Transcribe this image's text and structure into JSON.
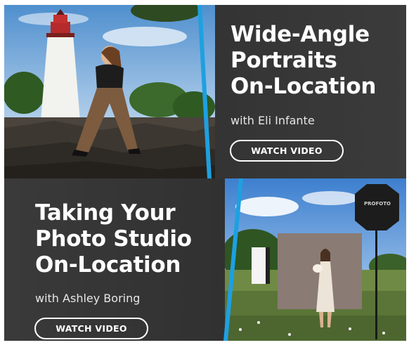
{
  "cards": [
    {
      "title_lines": [
        "Wide-Angle",
        "Portraits",
        "On-Location"
      ],
      "byline": "with Eli Infante",
      "button_label": "WATCH VIDEO",
      "accent_color": "#1ea0e0"
    },
    {
      "title_lines": [
        "Taking Your",
        "Photo Studio",
        "On-Location"
      ],
      "byline": "with Ashley Boring",
      "button_label": "WATCH VIDEO",
      "accent_color": "#1ea0e0"
    }
  ],
  "softbox_brand": "PROFOTO"
}
